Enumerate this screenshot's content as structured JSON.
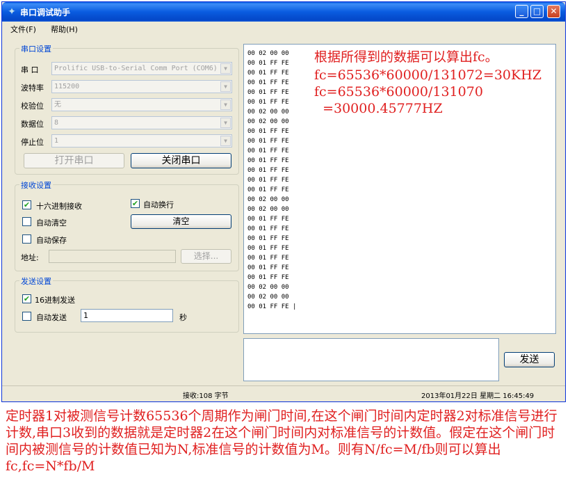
{
  "window": {
    "title": "串口调试助手",
    "buttons": {
      "minimize": "_",
      "maximize": "□",
      "close": "✕"
    }
  },
  "menu": {
    "file": "文件(F)",
    "help": "帮助(H)"
  },
  "serial_settings": {
    "title": "串口设置",
    "port_label": "串  口",
    "port_value": "Prolific USB-to-Serial Comm Port (COM6)",
    "baud_label": "波特率",
    "baud_value": "115200",
    "parity_label": "校验位",
    "parity_value": "无",
    "databits_label": "数据位",
    "databits_value": "8",
    "stopbits_label": "停止位",
    "stopbits_value": "1",
    "open_button": "打开串口",
    "close_button": "关闭串口"
  },
  "receive_settings": {
    "title": "接收设置",
    "hex_receive": "十六进制接收",
    "hex_receive_checked": true,
    "auto_newline": "自动换行",
    "auto_newline_checked": true,
    "auto_clear": "自动清空",
    "auto_clear_checked": false,
    "clear_button": "清空",
    "auto_save": "自动保存",
    "auto_save_checked": false,
    "address_label": "地址:",
    "address_value": "",
    "choose_button": "选择..."
  },
  "send_settings": {
    "title": "发送设置",
    "hex_send": "16进制发送",
    "hex_send_checked": true,
    "auto_send": "自动发送",
    "auto_send_checked": false,
    "interval_value": "1",
    "interval_unit": "秒"
  },
  "receive_area": {
    "lines": [
      "00 02 00 00",
      "00 01 FF FE",
      "00 01 FF FE",
      "00 01 FF FE",
      "00 01 FF FE",
      "00 01 FF FE",
      "00 02 00 00",
      "00 02 00 00",
      "00 01 FF FE",
      "00 01 FF FE",
      "00 01 FF FE",
      "00 01 FF FE",
      "00 01 FF FE",
      "00 01 FF FE",
      "00 01 FF FE",
      "00 02 00 00",
      "00 02 00 00",
      "00 01 FF FE",
      "00 01 FF FE",
      "00 01 FF FE",
      "00 01 FF FE",
      "00 01 FF FE",
      "00 01 FF FE",
      "00 01 FF FE",
      "00 02 00 00",
      "00 02 00 00",
      "00 01 FF FE |"
    ],
    "annotation_1": "根据所得到的数据可以算出fc。",
    "annotation_2": "fc=65536*60000/131072=30KHZ",
    "annotation_3": "fc=65536*60000/131070",
    "annotation_4": "  =30000.45777HZ"
  },
  "send_area": {
    "value": "",
    "send_button": "发送"
  },
  "status": {
    "received": "接收:108 字节",
    "datetime": "2013年01月22日 星期二 16:45:49"
  },
  "caption": "定时器1对被测信号计数65536个周期作为闸门时间,在这个闸门时间内定时器2对标准信号进行计数,串口3收到的数据就是定时器2在这个闸门时间内对标准信号的计数值。假定在这个闸门时间内被测信号的计数值已知为N,标准信号的计数值为M。则有N/fc=M/fb则可以算出fc,fc=N*fb/M"
}
